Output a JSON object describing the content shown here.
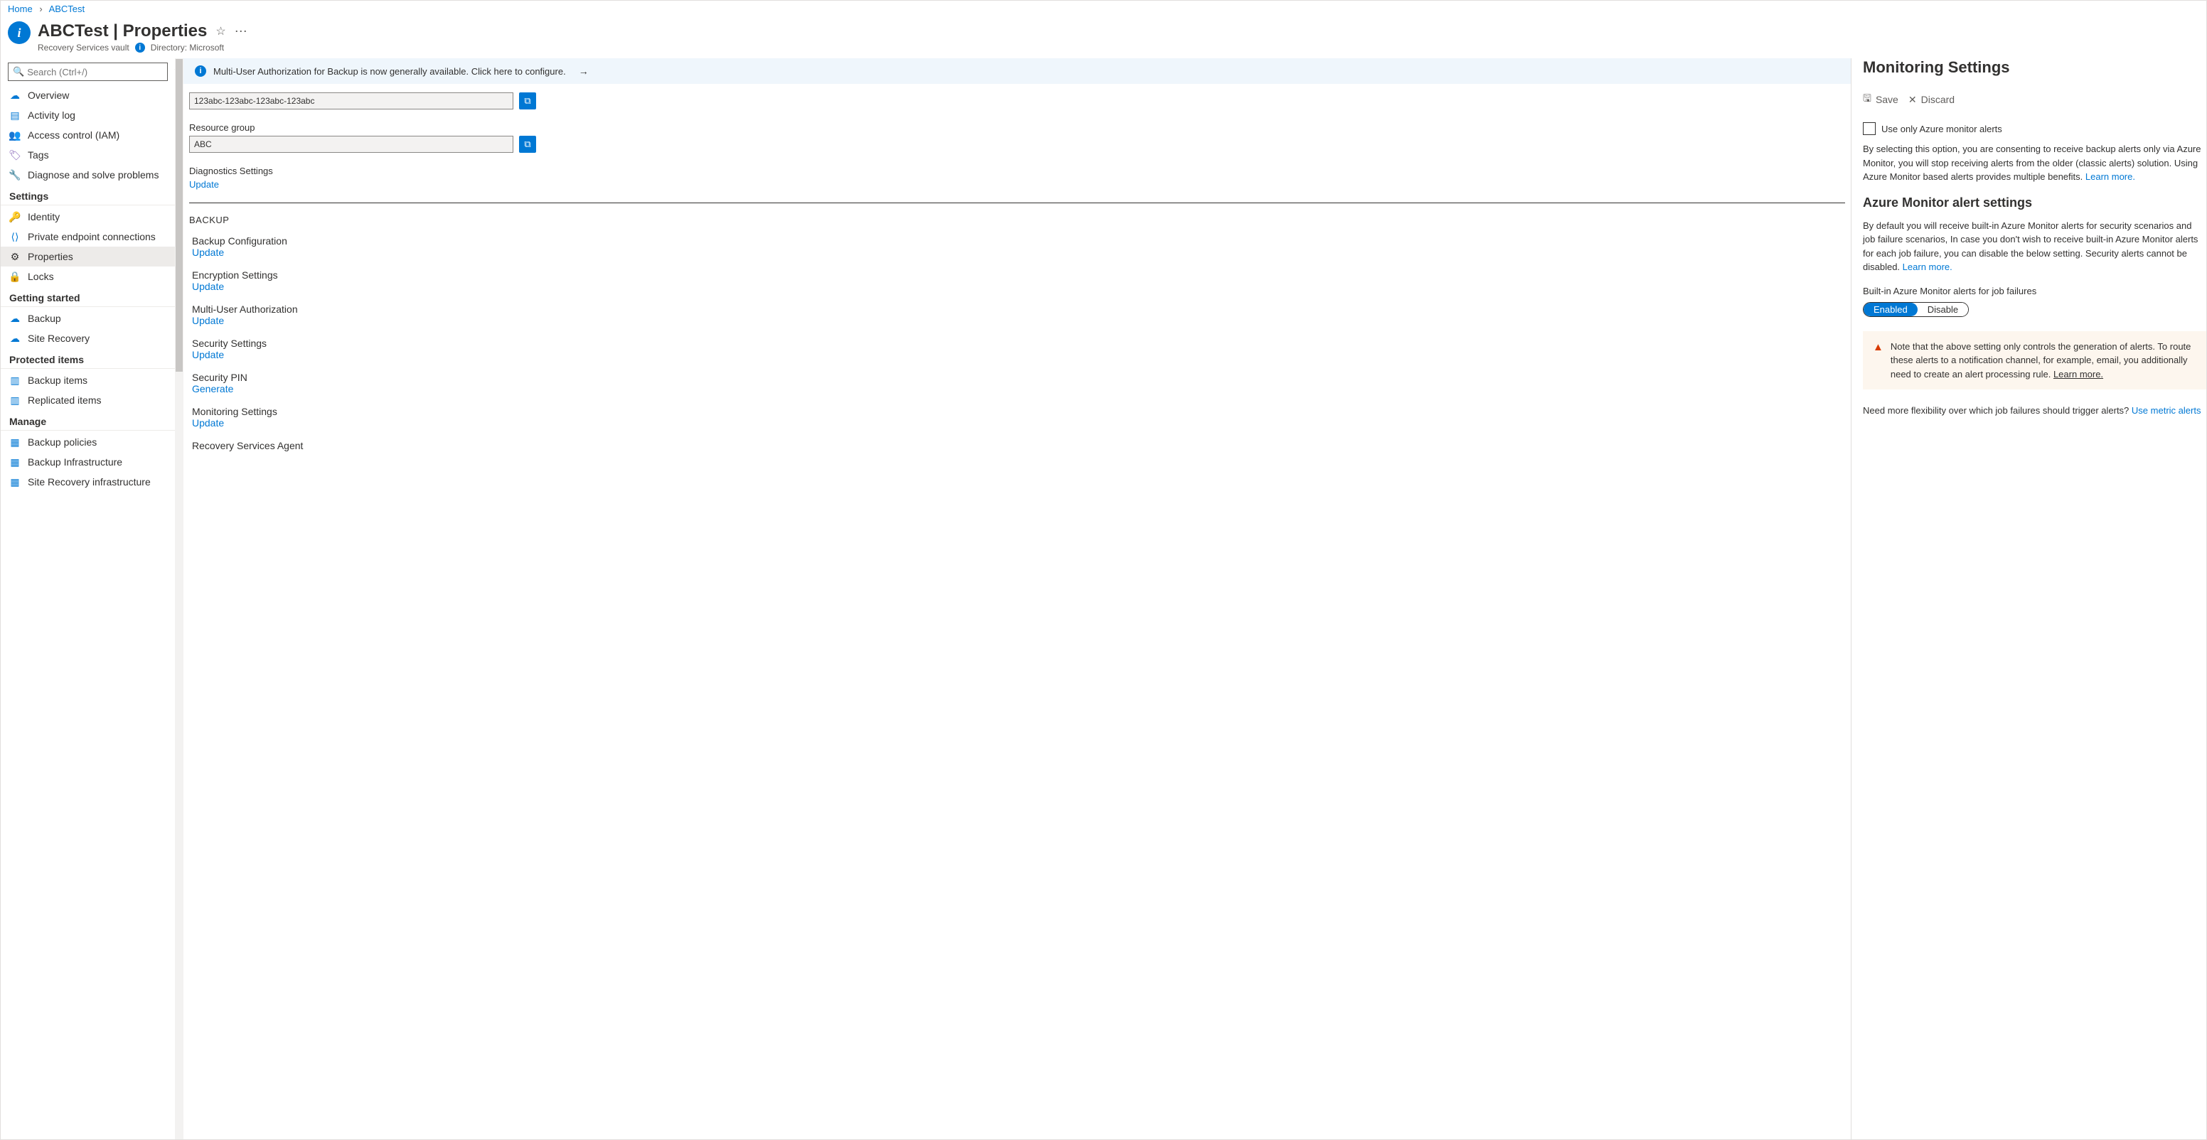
{
  "breadcrumb": {
    "home": "Home",
    "current": "ABCTest"
  },
  "header": {
    "resource_name": "ABCTest",
    "page_title": "Properties",
    "subtitle": "Recovery Services vault",
    "directory_label": "Directory: Microsoft"
  },
  "search": {
    "placeholder": "Search (Ctrl+/)"
  },
  "nav": {
    "top": [
      {
        "icon": "cloud-icon",
        "label": "Overview",
        "glyph": "☁",
        "cls": "ic-blue"
      },
      {
        "icon": "log-icon",
        "label": "Activity log",
        "glyph": "▤",
        "cls": "ic-blue"
      },
      {
        "icon": "users-icon",
        "label": "Access control (IAM)",
        "glyph": "👥",
        "cls": "ic-blue"
      },
      {
        "icon": "tag-icon",
        "label": "Tags",
        "glyph": "🏷",
        "cls": "ic-purple"
      },
      {
        "icon": "wrench-icon",
        "label": "Diagnose and solve problems",
        "glyph": "🔧",
        "cls": "ic-key"
      }
    ],
    "settings_title": "Settings",
    "settings": [
      {
        "icon": "identity-icon",
        "label": "Identity",
        "glyph": "🔑",
        "cls": "ic-yellow"
      },
      {
        "icon": "endpoint-icon",
        "label": "Private endpoint connections",
        "glyph": "⟨⟩",
        "cls": "ic-blue"
      },
      {
        "icon": "properties-icon",
        "label": "Properties",
        "glyph": "⚙",
        "cls": "",
        "active": true
      },
      {
        "icon": "lock-icon",
        "label": "Locks",
        "glyph": "🔒",
        "cls": "ic-blue"
      }
    ],
    "getting_title": "Getting started",
    "getting": [
      {
        "icon": "backup-icon",
        "label": "Backup",
        "glyph": "☁",
        "cls": "ic-blue"
      },
      {
        "icon": "recovery-icon",
        "label": "Site Recovery",
        "glyph": "☁",
        "cls": "ic-blue"
      }
    ],
    "protected_title": "Protected items",
    "protected": [
      {
        "icon": "items-icon",
        "label": "Backup items",
        "glyph": "▥",
        "cls": "ic-blue"
      },
      {
        "icon": "replicated-icon",
        "label": "Replicated items",
        "glyph": "▥",
        "cls": "ic-blue"
      }
    ],
    "manage_title": "Manage",
    "manage": [
      {
        "icon": "policies-icon",
        "label": "Backup policies",
        "glyph": "▦",
        "cls": "ic-blue"
      },
      {
        "icon": "infra-icon",
        "label": "Backup Infrastructure",
        "glyph": "▦",
        "cls": "ic-blue"
      },
      {
        "icon": "site-infra-icon",
        "label": "Site Recovery infrastructure",
        "glyph": "▦",
        "cls": "ic-blue"
      }
    ]
  },
  "main": {
    "banner": "Multi-User Authorization for Backup is now generally available. Click here to configure.",
    "id_value": "123abc-123abc-123abc-123abc",
    "rg_label": "Resource group",
    "rg_value": "ABC",
    "diag_label": "Diagnostics Settings",
    "diag_action": "Update",
    "backup_section": "BACKUP",
    "items": [
      {
        "label": "Backup Configuration",
        "action": "Update"
      },
      {
        "label": "Encryption Settings",
        "action": "Update"
      },
      {
        "label": "Multi-User Authorization",
        "action": "Update"
      },
      {
        "label": "Security Settings",
        "action": "Update"
      },
      {
        "label": "Security PIN",
        "action": "Generate"
      },
      {
        "label": "Monitoring Settings",
        "action": "Update"
      },
      {
        "label": "Recovery Services Agent",
        "action": ""
      }
    ]
  },
  "panel": {
    "title": "Monitoring Settings",
    "save": "Save",
    "discard": "Discard",
    "checkbox_label": "Use only Azure monitor alerts",
    "para1": "By selecting this option, you are consenting to receive backup alerts only via Azure Monitor, you will stop receiving alerts from the older (classic alerts) solution. Using Azure Monitor based alerts provides multiple benefits.",
    "learn_more": "Learn more.",
    "subtitle": "Azure Monitor alert settings",
    "para2": "By default you will receive built-in Azure Monitor alerts for security scenarios and job failure scenarios, In case you don't wish to receive built-in Azure Monitor alerts for each job failure, you can disable the below setting. Security alerts cannot be disabled.",
    "toggle_label": "Built-in Azure Monitor alerts for job failures",
    "toggle_on": "Enabled",
    "toggle_off": "Disable",
    "warn": "Note that the above setting only controls the generation of alerts. To route these alerts to a notification channel, for example, email, you additionally need to create an alert processing rule.",
    "warn_link": "Learn more.",
    "footer_q": "Need more flexibility over which job failures should trigger alerts?",
    "footer_link": "Use metric alerts"
  }
}
